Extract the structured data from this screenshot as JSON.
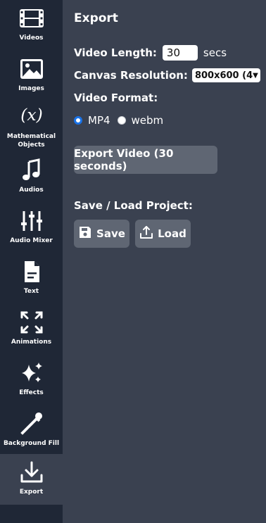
{
  "sidebar": {
    "items": [
      {
        "label": "Videos",
        "icon": "film-icon"
      },
      {
        "label": "Images",
        "icon": "image-icon"
      },
      {
        "label": "Mathematical Objects",
        "icon": "function-icon"
      },
      {
        "label": "Audios",
        "icon": "music-note-icon"
      },
      {
        "label": "Audio Mixer",
        "icon": "sliders-icon"
      },
      {
        "label": "Text",
        "icon": "document-icon"
      },
      {
        "label": "Animations",
        "icon": "expand-arrows-icon"
      },
      {
        "label": "Effects",
        "icon": "sparkles-icon"
      },
      {
        "label": "Background Fill",
        "icon": "eyedropper-icon"
      },
      {
        "label": "Export",
        "icon": "download-icon",
        "active": true
      }
    ]
  },
  "export": {
    "title": "Export",
    "video_length_label": "Video Length:",
    "video_length_value": "30",
    "video_length_unit": "secs",
    "canvas_resolution_label": "Canvas Resolution:",
    "canvas_resolution_value": "800x600 (4",
    "video_format_label": "Video Format:",
    "format_options": [
      {
        "label": "MP4",
        "selected": true
      },
      {
        "label": "webm",
        "selected": false
      }
    ],
    "export_button": "Export Video (30 seconds)"
  },
  "project": {
    "title": "Save / Load Project:",
    "save_label": "Save",
    "load_label": "Load"
  },
  "colors": {
    "sidebar_bg": "#1f2736",
    "panel_bg": "#3a4150",
    "button_bg": "#5f6673",
    "radio_accent": "#1a73e8"
  }
}
